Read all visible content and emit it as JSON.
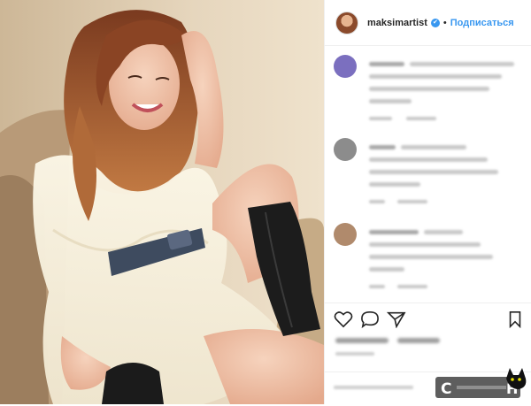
{
  "post": {
    "username": "maksimartist",
    "verified_icon": "verified-badge-icon",
    "separator": "•",
    "follow_label": "Подписаться"
  },
  "actions": {
    "icons": [
      "heart-icon",
      "comment-icon",
      "share-icon",
      "bookmark-icon"
    ]
  },
  "watermark": {
    "text": "С..........Н",
    "icon": "cat-silhouette-icon"
  },
  "colors": {
    "accent": "#3897f0",
    "text": "#262626",
    "divider": "#efefef"
  }
}
